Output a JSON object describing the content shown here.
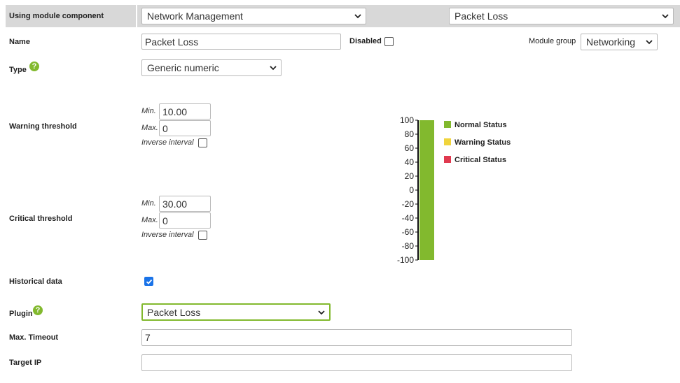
{
  "header": {
    "using_label": "Using module component",
    "component_group": "Network Management",
    "component": "Packet Loss"
  },
  "name": {
    "label": "Name",
    "value": "Packet Loss",
    "disabled_label": "Disabled",
    "disabled_checked": false,
    "module_group_label": "Module group",
    "module_group": "Networking"
  },
  "type": {
    "label": "Type",
    "value": "Generic numeric",
    "help_icon": "help-icon"
  },
  "warning": {
    "label": "Warning threshold",
    "min_label": "Min.",
    "min_value": "10.00",
    "max_label": "Max.",
    "max_value": "0",
    "inverse_label": "Inverse interval",
    "inverse_checked": false
  },
  "critical": {
    "label": "Critical threshold",
    "min_label": "Min.",
    "min_value": "30.00",
    "max_label": "Max.",
    "max_value": "0",
    "inverse_label": "Inverse interval",
    "inverse_checked": false
  },
  "historical": {
    "label": "Historical data",
    "checked": true
  },
  "plugin": {
    "label": "Plugin",
    "value": "Packet Loss",
    "help_icon": "help-icon"
  },
  "timeout": {
    "label": "Max. Timeout",
    "value": "7"
  },
  "target_ip": {
    "label": "Target IP",
    "value": ""
  },
  "colors": {
    "accent": "#82b92e",
    "normal": "#82b92e",
    "warning": "#f0d43c",
    "critical": "#e0394f"
  },
  "chart_data": {
    "type": "bar",
    "ylim": [
      -100,
      100
    ],
    "y_ticks": [
      "100",
      "80",
      "60",
      "40",
      "20",
      "0",
      "-20",
      "-40",
      "-60",
      "-80",
      "-100"
    ],
    "bands": [
      {
        "name": "Normal Status",
        "from": -100,
        "to": 100,
        "color": "#82b92e"
      }
    ],
    "legend": [
      "Normal Status",
      "Warning Status",
      "Critical Status"
    ],
    "legend_colors": [
      "#82b92e",
      "#f0d43c",
      "#e0394f"
    ],
    "legend_position": "right"
  }
}
